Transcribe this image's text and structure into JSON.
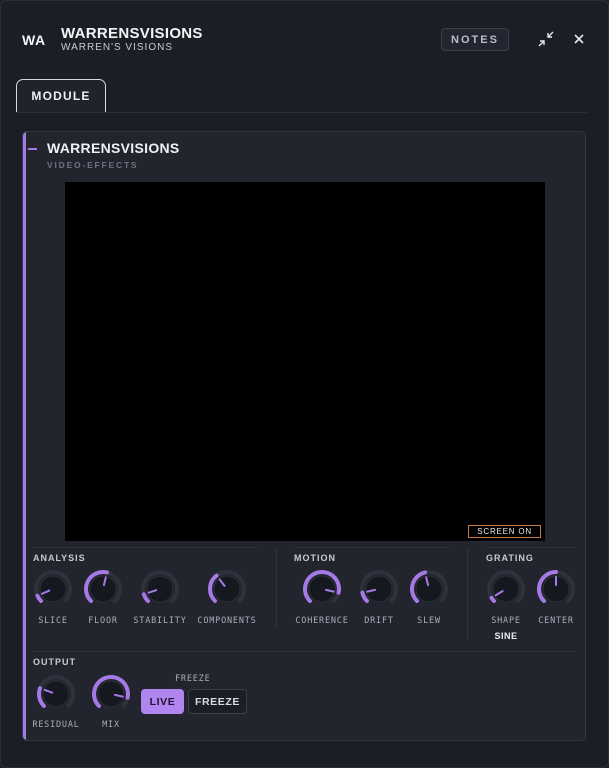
{
  "header": {
    "logo": "WA",
    "title": "WARRENSVISIONS",
    "subtitle": "WARREN'S VISIONS",
    "notes_label": "NOTES"
  },
  "tabs": [
    {
      "label": "MODULE",
      "active": true
    }
  ],
  "module": {
    "title": "WARRENSVISIONS",
    "subtitle": "VIDEO-EFFECTS",
    "accent_color": "#a57ae6",
    "screen_badge": "SCREEN ON"
  },
  "sections": {
    "analysis": {
      "label": "ANALYSIS",
      "knobs": [
        {
          "label": "SLICE",
          "value": 0.08
        },
        {
          "label": "FLOOR",
          "value": 0.55
        },
        {
          "label": "STABILITY",
          "value": 0.1
        },
        {
          "label": "COMPONENTS",
          "value": 0.36
        }
      ]
    },
    "motion": {
      "label": "MOTION",
      "knobs": [
        {
          "label": "COHERENCE",
          "value": 0.88
        },
        {
          "label": "DRIFT",
          "value": 0.12
        },
        {
          "label": "SLEW",
          "value": 0.45
        }
      ]
    },
    "grating": {
      "label": "GRATING",
      "knobs": [
        {
          "label": "SHAPE",
          "value": 0.05,
          "display": "SINE"
        },
        {
          "label": "CENTER",
          "value": 0.5
        }
      ]
    },
    "output": {
      "label": "OUTPUT",
      "knobs": [
        {
          "label": "RESIDUAL",
          "value": 0.24
        },
        {
          "label": "MIX",
          "value": 0.88
        }
      ],
      "freeze": {
        "label": "FREEZE",
        "options": [
          "LIVE",
          "FREEZE"
        ],
        "selected": "LIVE"
      }
    }
  }
}
